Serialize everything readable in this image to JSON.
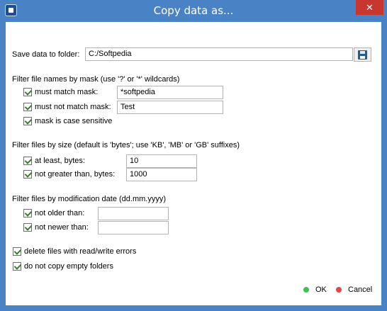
{
  "window": {
    "title": "Copy data as...",
    "close_glyph": "✕"
  },
  "save": {
    "label": "Save data to folder:",
    "value": "C:/Softpedia",
    "icon": "floppy-disk-icon"
  },
  "mask": {
    "heading": "Filter file names by mask (use '?' or '*' wildcards)",
    "must_match_label": "must match mask:",
    "must_match_value": "*softpedia",
    "must_not_match_label": "must not match mask:",
    "must_not_match_value": "Test",
    "case_sensitive_label": "mask is case sensitive"
  },
  "size": {
    "heading": "Filter files by size (default is 'bytes'; use 'KB', 'MB' or 'GB' suffixes)",
    "at_least_label": "at least, bytes:",
    "at_least_value": "10",
    "not_greater_label": "not greater than, bytes:",
    "not_greater_value": "1000"
  },
  "date": {
    "heading": "Filter files by modification date (dd.mm.yyyy)",
    "not_older_label": "not older than:",
    "not_older_value": "",
    "not_newer_label": "not newer than:",
    "not_newer_value": ""
  },
  "options": {
    "delete_errors_label": "delete files with read/write errors",
    "no_empty_label": "do not copy empty folders"
  },
  "buttons": {
    "ok_label": "OK",
    "cancel_label": "Cancel"
  },
  "colors": {
    "title_bar": "#4a82c6",
    "close_button": "#c7372f",
    "ok_dot": "#3fbf5a",
    "cancel_dot": "#e0474c",
    "check": "#3b7c2e"
  }
}
